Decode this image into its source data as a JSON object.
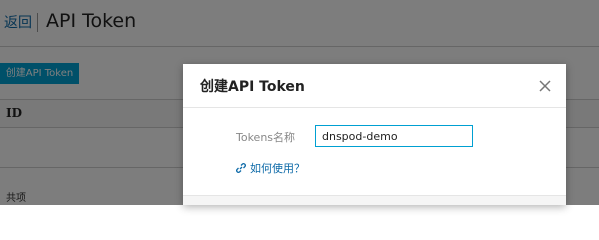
{
  "header": {
    "back_label": "返回",
    "title": "API Token"
  },
  "toolbar": {
    "create_label": "创建API Token"
  },
  "table": {
    "columns": [
      "ID"
    ]
  },
  "footer": {
    "text": "共项"
  },
  "modal": {
    "title": "创建API Token",
    "close_icon": "close-icon",
    "field_label": "Tokens名称",
    "field_value": "dnspod-demo",
    "help_label": "如何使用？",
    "help_icon": "link-icon"
  }
}
